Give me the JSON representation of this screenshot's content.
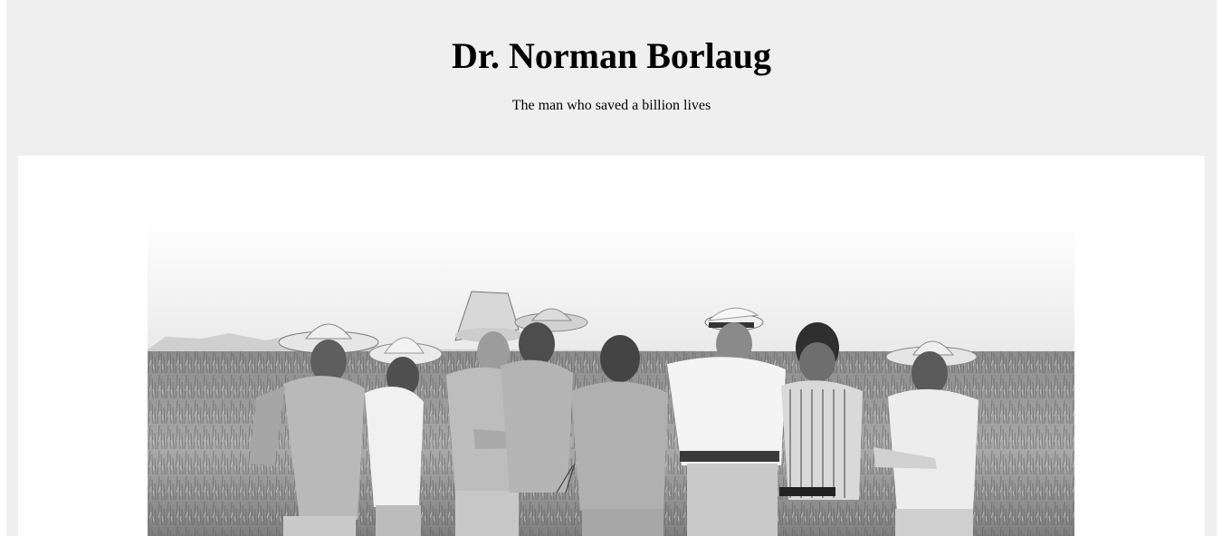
{
  "header": {
    "title": "Dr. Norman Borlaug",
    "subtitle": "The man who saved a billion lives"
  },
  "image": {
    "description": "Black and white photograph of Norman Borlaug with a group of men in a wheat field"
  }
}
